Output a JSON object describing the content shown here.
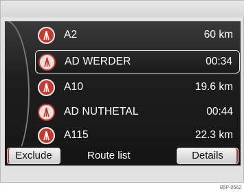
{
  "route_list": {
    "items": [
      {
        "label": "A2",
        "value": "60 km",
        "icon": "motorway-icon",
        "style": "filled"
      },
      {
        "label": "AD WERDER",
        "value": "00:34",
        "icon": "motorway-junction-icon",
        "style": "outline",
        "selected": true
      },
      {
        "label": "A10",
        "value": "19.6 km",
        "icon": "motorway-icon",
        "style": "filled"
      },
      {
        "label": "AD NUTHETAL",
        "value": "00:44",
        "icon": "motorway-junction-icon",
        "style": "outline"
      },
      {
        "label": "A115",
        "value": "22.3 km",
        "icon": "motorway-icon",
        "style": "filled"
      }
    ]
  },
  "softkeys": {
    "left_label": "Exclude",
    "title": "Route list",
    "right_label": "Details"
  },
  "figure_code": "B5P-0562",
  "colors": {
    "accent_red": "#c8382f",
    "screen_bg": "#1e1e1e",
    "text": "#ffffff"
  }
}
